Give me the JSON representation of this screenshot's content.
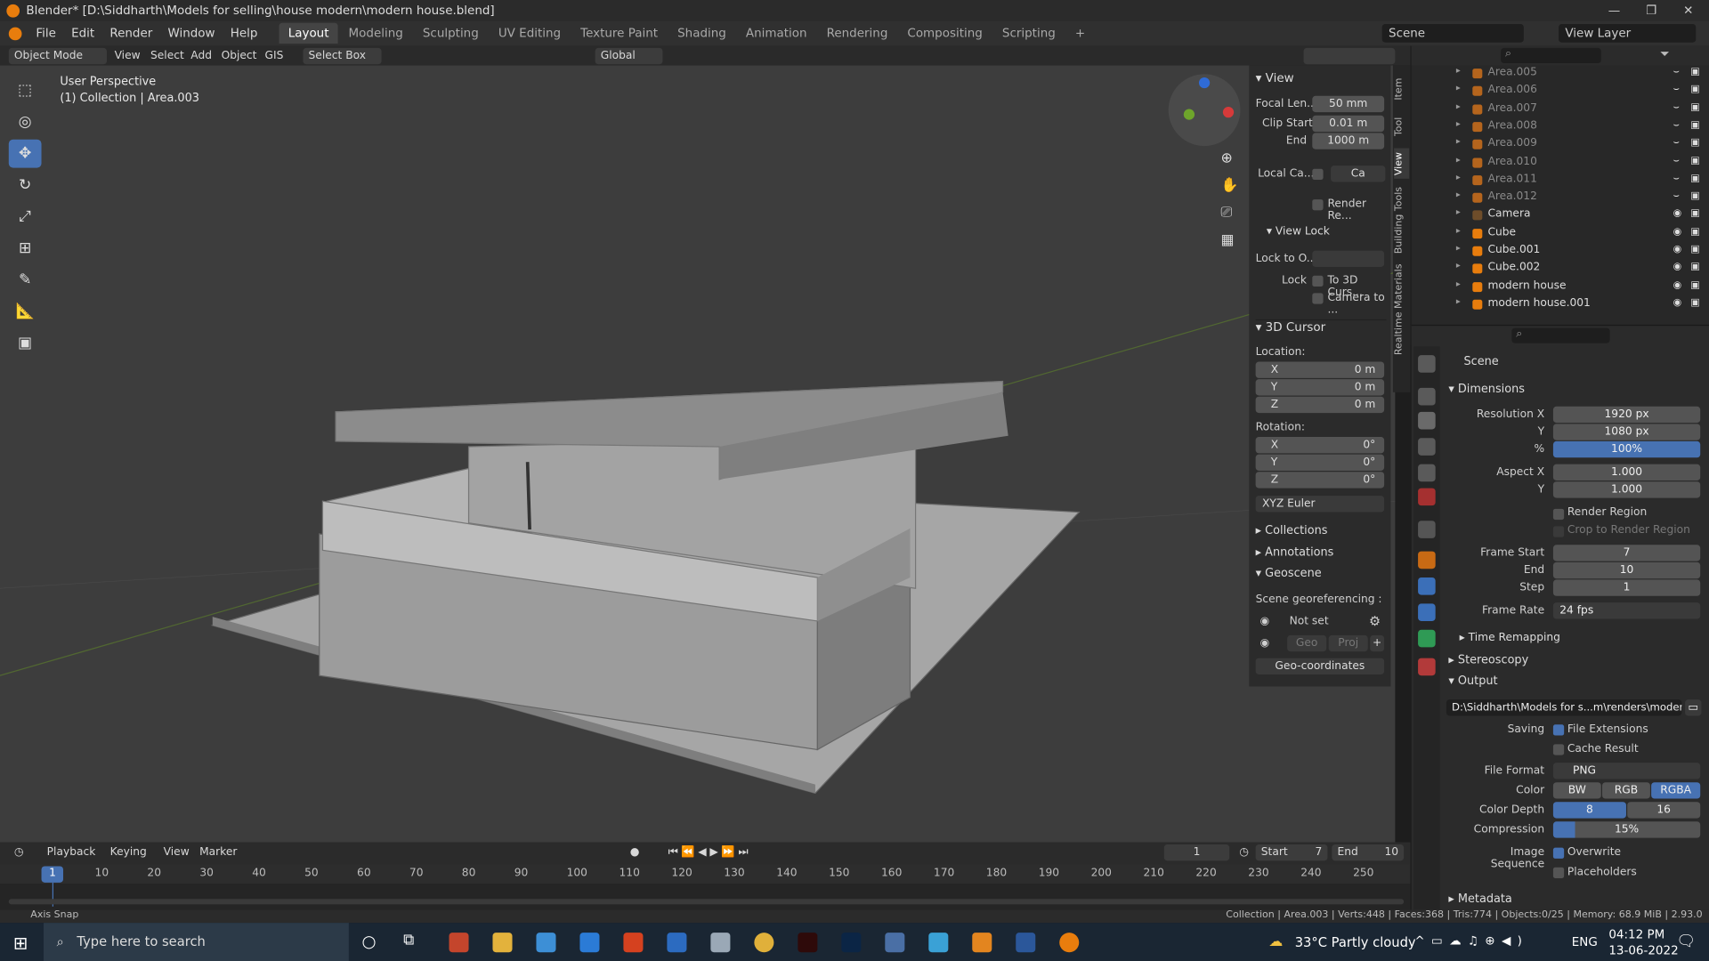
{
  "window": {
    "title": "Blender* [D:\\Siddharth\\Models for selling\\house modern\\modern house.blend]"
  },
  "menu": [
    "File",
    "Edit",
    "Render",
    "Window",
    "Help"
  ],
  "workspaces": [
    "Layout",
    "Modeling",
    "Sculpting",
    "UV Editing",
    "Texture Paint",
    "Shading",
    "Animation",
    "Rendering",
    "Compositing",
    "Scripting"
  ],
  "scene": {
    "label": "Scene",
    "view_layer": "View Layer"
  },
  "viewport_header": {
    "mode": "Object Mode",
    "view": "View",
    "select": "Select",
    "add": "Add",
    "object": "Object",
    "gis": "GIS",
    "select_box": "Select Box",
    "orientation": "Global"
  },
  "viewport": {
    "perspective": "User Perspective",
    "collection": "(1) Collection | Area.003"
  },
  "npanel": {
    "view_header": "View",
    "focal_label": "Focal Len...",
    "focal": "50 mm",
    "clip_start_label": "Clip Start",
    "clip_start": "0.01 m",
    "clip_end_label": "End",
    "clip_end": "1000 m",
    "local_camera_label": "Local Ca...",
    "local_camera_value": "Ca",
    "render_region": "Render Re...",
    "view_lock_header": "View Lock",
    "lock_to_label": "Lock to O...",
    "lock_label": "Lock",
    "to_3d_cursor": "To 3D Curs...",
    "camera_to": "Camera to ...",
    "cursor_header": "3D Cursor",
    "location_label": "Location:",
    "x": "X",
    "y": "Y",
    "z": "Z",
    "loc_x": "0 m",
    "loc_y": "0 m",
    "loc_z": "0 m",
    "rotation_label": "Rotation:",
    "rot_x": "0°",
    "rot_y": "0°",
    "rot_z": "0°",
    "rotation_mode": "XYZ Euler",
    "collections": "Collections",
    "annotations": "Annotations",
    "geoscene": "Geoscene",
    "georef_label": "Scene georeferencing :",
    "not_set": "Not set",
    "geo": "Geo",
    "proj": "Proj",
    "geo_coordinates": "Geo-coordinates"
  },
  "side_tabs": [
    "Item",
    "Tool",
    "View",
    "Building Tools",
    "Realtime Materials"
  ],
  "outliner": [
    {
      "name": "Area.005",
      "type": "light",
      "visible": false
    },
    {
      "name": "Area.006",
      "type": "light",
      "visible": false
    },
    {
      "name": "Area.007",
      "type": "light",
      "visible": false
    },
    {
      "name": "Area.008",
      "type": "light",
      "visible": false
    },
    {
      "name": "Area.009",
      "type": "light",
      "visible": false
    },
    {
      "name": "Area.010",
      "type": "light",
      "visible": false
    },
    {
      "name": "Area.011",
      "type": "light",
      "visible": false
    },
    {
      "name": "Area.012",
      "type": "light",
      "visible": false
    },
    {
      "name": "Camera",
      "type": "camera",
      "visible": true
    },
    {
      "name": "Cube",
      "type": "mesh",
      "visible": true
    },
    {
      "name": "Cube.001",
      "type": "mesh",
      "visible": true
    },
    {
      "name": "Cube.002",
      "type": "mesh",
      "visible": true
    },
    {
      "name": "modern house",
      "type": "mesh",
      "visible": true
    },
    {
      "name": "modern house.001",
      "type": "mesh",
      "visible": true
    }
  ],
  "properties": {
    "context": "Scene",
    "dimensions": "Dimensions",
    "res_x_label": "Resolution X",
    "res_x": "1920 px",
    "res_y_label": "Y",
    "res_y": "1080 px",
    "res_pct_label": "%",
    "res_pct": "100%",
    "aspect_x_label": "Aspect X",
    "aspect_x": "1.000",
    "aspect_y_label": "Y",
    "aspect_y": "1.000",
    "render_region": "Render Region",
    "crop": "Crop to Render Region",
    "frame_start_label": "Frame Start",
    "frame_start": "7",
    "frame_end_label": "End",
    "frame_end": "10",
    "step_label": "Step",
    "step": "1",
    "frame_rate_label": "Frame Rate",
    "frame_rate": "24 fps",
    "time_remapping": "Time Remapping",
    "stereoscopy": "Stereoscopy",
    "output": "Output",
    "output_path": "D:\\Siddharth\\Models for s...m\\renders\\modern house",
    "saving_label": "Saving",
    "file_extensions": "File Extensions",
    "cache_result": "Cache Result",
    "file_format_label": "File Format",
    "file_format": "PNG",
    "color_label": "Color",
    "bw": "BW",
    "rgb": "RGB",
    "rgba": "RGBA",
    "color_depth_label": "Color Depth",
    "depth_8": "8",
    "depth_16": "16",
    "compression_label": "Compression",
    "compression": "15%",
    "image_sequence_label": "Image Sequence",
    "overwrite": "Overwrite",
    "placeholders": "Placeholders",
    "metadata": "Metadata"
  },
  "timeline": {
    "playback": "Playback",
    "keying": "Keying",
    "view": "View",
    "marker": "Marker",
    "current": "1",
    "start_label": "Start",
    "start": "7",
    "end_label": "End",
    "end": "10",
    "ticks": [
      "1",
      "10",
      "20",
      "30",
      "40",
      "50",
      "60",
      "70",
      "80",
      "90",
      "100",
      "110",
      "120",
      "130",
      "140",
      "150",
      "160",
      "170",
      "180",
      "190",
      "200",
      "210",
      "220",
      "230",
      "240",
      "250"
    ]
  },
  "status": {
    "left": "Axis Snap",
    "right": "Collection | Area.003 | Verts:448 | Faces:368 | Tris:774 | Objects:0/25 | Memory: 68.9 MiB | 2.93.0"
  },
  "taskbar": {
    "search": "Type here to search",
    "weather": "33°C  Partly cloudy",
    "lang": "ENG",
    "time": "04:12 PM",
    "date": "13-06-2022"
  },
  "colors": {
    "accent": "#4772b3",
    "orange": "#e87d0d",
    "viewport_bg": "#3d3d3d"
  }
}
